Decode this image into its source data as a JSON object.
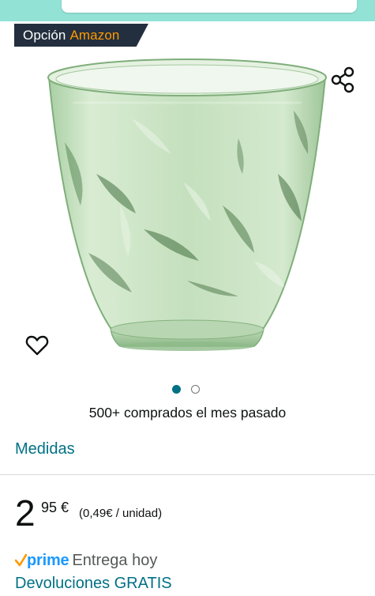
{
  "header": {
    "search_placeholder": ""
  },
  "badge": {
    "prefix": "Opción",
    "brand": "Amazon"
  },
  "gallery": {
    "image_icon": "green-glass-tumbler",
    "share_icon": "share-icon",
    "favorite_icon": "heart-outline-icon",
    "slides_count": 2,
    "active_slide": 1
  },
  "social_proof": {
    "bought_text": "500+ comprados el mes pasado"
  },
  "variants": {
    "label": "Medidas"
  },
  "price": {
    "whole": "2",
    "fraction": "95 €",
    "unit_price": "(0,49€ / unidad)"
  },
  "delivery": {
    "prime_label": "prime",
    "text": "Entrega hoy"
  },
  "returns": {
    "label": "Devoluciones GRATIS"
  },
  "colors": {
    "accent_teal": "#007185",
    "prime_blue": "#1a98ff",
    "badge_bg": "#232f3e",
    "badge_brand": "#ff9900",
    "top_band": "#93e2d6"
  }
}
